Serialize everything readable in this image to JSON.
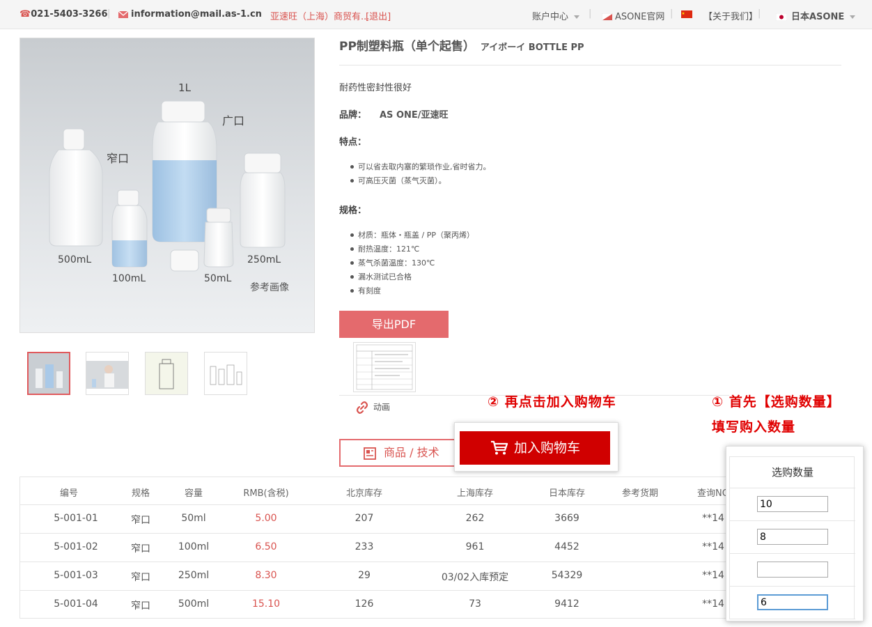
{
  "topbar": {
    "phone": "021-5403-3266",
    "email": "information@mail.as-1.cn",
    "user": "亚速旺（上海）商贸有...",
    "logout": "[退出]",
    "account": "账户中心",
    "official": "ASONE官网",
    "about": "【关于我们】",
    "japan": "日本ASONE"
  },
  "product": {
    "title": "PP制塑料瓶（单个起售）",
    "subtitle": "アイボーイ BOTTLE PP",
    "description": "耐药性密封性很好",
    "brand_label": "品牌：",
    "brand_value": "AS ONE/亚速旺",
    "features_label": "特点：",
    "features": [
      "可以省去取内塞的繁琐作业,省时省力。",
      "可高压灭菌（蒸气灭菌）。"
    ],
    "spec_label": "规格：",
    "specs": [
      "材质：瓶体・瓶盖 / PP（聚丙烯）",
      "耐热温度：121℃",
      "蒸气杀菌温度：130℃",
      "漏水测试已合格",
      "有刻度"
    ],
    "image_labels": {
      "l1": "1L",
      "wide": "广口",
      "narrow": "窄口",
      "ml500": "500mL",
      "ml100": "100mL",
      "ml50": "50mL",
      "ml250": "250mL",
      "ref": "参考画像"
    }
  },
  "buttons": {
    "pdf": "导出PDF",
    "animation": "动画",
    "tech": "商品 / 技术",
    "cart": "加入购物车"
  },
  "annotations": {
    "step2": "② 再点击加入购物车",
    "step1_line1": "① 首先【选购数量】",
    "step1_line2": "填写购入数量"
  },
  "table": {
    "headers": [
      "编号",
      "规格",
      "容量",
      "RMB(含税)",
      "北京库存",
      "上海库存",
      "日本库存",
      "参考货期",
      "查询NO"
    ],
    "rows": [
      {
        "code": "5-001-01",
        "spec": "窄口",
        "cap": "50ml",
        "price": "5.00",
        "bj": "207",
        "sh": "262",
        "jp": "3669",
        "lead": "",
        "no": "**14"
      },
      {
        "code": "5-001-02",
        "spec": "窄口",
        "cap": "100ml",
        "price": "6.50",
        "bj": "233",
        "sh": "961",
        "jp": "4452",
        "lead": "",
        "no": "**14"
      },
      {
        "code": "5-001-03",
        "spec": "窄口",
        "cap": "250ml",
        "price": "8.30",
        "bj": "29",
        "sh": "03/02入库预定",
        "jp": "54329",
        "lead": "",
        "no": "**14"
      },
      {
        "code": "5-001-04",
        "spec": "窄口",
        "cap": "500ml",
        "price": "15.10",
        "bj": "126",
        "sh": "73",
        "jp": "9412",
        "lead": "",
        "no": "**14"
      }
    ]
  },
  "quantity": {
    "header": "选购数量",
    "values": [
      "10",
      "8",
      "",
      "6"
    ]
  },
  "colors": {
    "accent": "#d00000",
    "annotation": "#e00000",
    "price": "#d9534f",
    "pdf_button": "#e46a6d"
  }
}
